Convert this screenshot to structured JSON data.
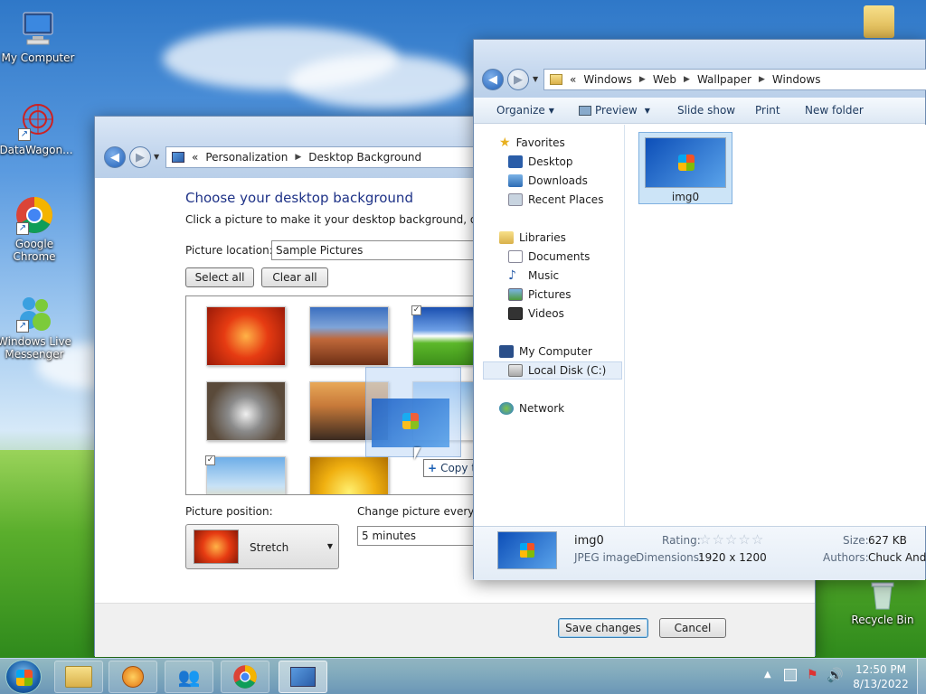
{
  "desktop": {
    "icons": [
      {
        "label": "My Computer"
      },
      {
        "label": "DataWagon..."
      },
      {
        "label": "Google Chrome"
      },
      {
        "label": "Windows Live Messenger"
      },
      {
        "label": "Recycle Bin"
      }
    ]
  },
  "personalization": {
    "breadcrumb": [
      "Personalization",
      "Desktop Background"
    ],
    "breadcrumb_prefix": "«",
    "heading": "Choose your desktop background",
    "subtext": "Click a picture to make it your desktop background, or select",
    "picture_location_label": "Picture location:",
    "picture_location_value": "Sample Pictures",
    "select_all": "Select all",
    "clear_all": "Clear all",
    "picture_position_label": "Picture position:",
    "picture_position_value": "Stretch",
    "change_every_label": "Change picture every:",
    "change_every_value": "5 minutes",
    "save_changes": "Save changes",
    "cancel": "Cancel",
    "drag_tooltip": "Copy to Sample Pictures"
  },
  "explorer": {
    "breadcrumb_prefix": "«",
    "breadcrumb": [
      "Windows",
      "Web",
      "Wallpaper",
      "Windows"
    ],
    "toolbar": {
      "organize": "Organize",
      "preview": "Preview",
      "slideshow": "Slide show",
      "print": "Print",
      "new_folder": "New folder"
    },
    "nav": {
      "favorites": "Favorites",
      "desktop": "Desktop",
      "downloads": "Downloads",
      "recent": "Recent Places",
      "libraries": "Libraries",
      "documents": "Documents",
      "music": "Music",
      "pictures": "Pictures",
      "videos": "Videos",
      "computer": "My Computer",
      "local_disk": "Local Disk (C:)",
      "network": "Network"
    },
    "file": {
      "name": "img0"
    },
    "details": {
      "name": "img0",
      "type": "JPEG image",
      "rating_label": "Rating:",
      "dimensions_label": "Dimensions:",
      "dimensions_value": "1920 x 1200",
      "size_label": "Size:",
      "size_value": "627 KB",
      "authors_label": "Authors:",
      "authors_value": "Chuck Ande"
    }
  },
  "taskbar": {
    "time": "12:50 PM",
    "date": "8/13/2022"
  }
}
